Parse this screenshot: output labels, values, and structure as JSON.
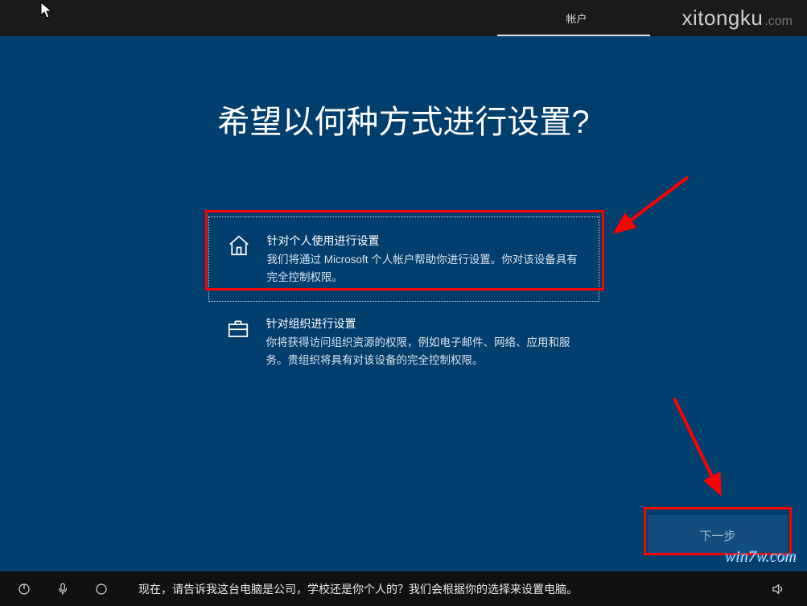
{
  "header": {
    "active_tab": "帐户",
    "brand_main": "xitongku",
    "brand_suffix": ".com"
  },
  "title": "希望以何种方式进行设置?",
  "options": [
    {
      "id": "personal",
      "title": "针对个人使用进行设置",
      "description": "我们将通过 Microsoft 个人帐户帮助你进行设置。你对该设备具有完全控制权限。",
      "selected": true
    },
    {
      "id": "organization",
      "title": "针对组织进行设置",
      "description": "你将获得访问组织资源的权限，例如电子邮件、网络、应用和服务。贵组织将具有对该设备的完全控制权限。",
      "selected": false
    }
  ],
  "buttons": {
    "next": "下一步"
  },
  "cortana": {
    "prompt": "现在，请告诉我这台电脑是公司，学校还是你个人的？我们会根据你的选择来设置电脑。"
  },
  "watermark": "win7w.com"
}
